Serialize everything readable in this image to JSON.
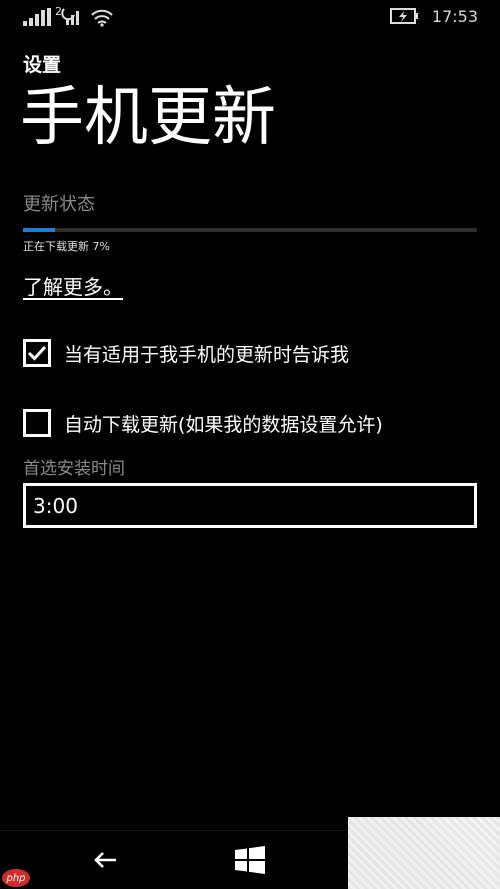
{
  "status": {
    "signal_icon": "signal-bars-icon",
    "network_icon": "two-g-icon",
    "sync_icon": "sync-icon",
    "wifi_icon": "wifi-icon",
    "battery_icon": "battery-charging-icon",
    "time": "17:53"
  },
  "header": {
    "app_name": "设置",
    "title": "手机更新"
  },
  "update": {
    "section_label": "更新状态",
    "progress_percent": 7,
    "progress_text": "正在下载更新 7%",
    "learn_more": "了解更多。"
  },
  "options": {
    "notify": {
      "label": "当有适用于我手机的更新时告诉我",
      "checked": true
    },
    "auto_download": {
      "label": "自动下载更新(如果我的数据设置允许)",
      "checked": false
    }
  },
  "install_time": {
    "label": "首选安装时间",
    "value": "3:00"
  },
  "nav": {
    "back_icon": "back-arrow-icon",
    "start_icon": "windows-logo-icon"
  },
  "watermark_text": "php",
  "colors": {
    "accent": "#1e7fd0",
    "background": "#000000"
  }
}
